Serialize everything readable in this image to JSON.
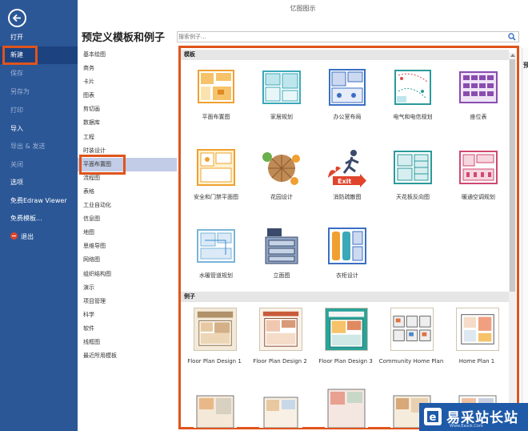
{
  "app": {
    "title": "亿图图示"
  },
  "sidebar": {
    "items": [
      {
        "label": "打开"
      },
      {
        "label": "新建"
      },
      {
        "label": "保存"
      },
      {
        "label": "另存为"
      },
      {
        "label": "打印"
      },
      {
        "label": "导入"
      },
      {
        "label": "导出 & 发送"
      },
      {
        "label": "关闭"
      },
      {
        "label": "选项"
      },
      {
        "label": "免费Edraw Viewer"
      },
      {
        "label": "免费模板..."
      },
      {
        "label": "退出"
      }
    ]
  },
  "header": {
    "title": "预定义模板和例子",
    "search_placeholder": "搜索例子..."
  },
  "categories": [
    "基本绘图",
    "商务",
    "卡片",
    "图表",
    "剪切画",
    "数据库",
    "工程",
    "时装设计",
    "平面布置图",
    "流程图",
    "表格",
    "工业自动化",
    "信息图",
    "地图",
    "思维导图",
    "网络图",
    "组织结构图",
    "演示",
    "项目管理",
    "科学",
    "软件",
    "线框图",
    "最近所用模板"
  ],
  "selected_category": "平面布置图",
  "templates": {
    "section_label": "模板",
    "items": [
      {
        "label": "平面布置图",
        "icon": "floor-plan-icon"
      },
      {
        "label": "家居规划",
        "icon": "home-plan-icon"
      },
      {
        "label": "办公室布局",
        "icon": "office-layout-icon"
      },
      {
        "label": "电气和电信规划",
        "icon": "electrical-plan-icon"
      },
      {
        "label": "座位表",
        "icon": "seating-chart-icon"
      },
      {
        "label": "安全和门禁平面图",
        "icon": "security-plan-icon"
      },
      {
        "label": "花园设计",
        "icon": "garden-design-icon"
      },
      {
        "label": "消防疏散图",
        "icon": "fire-escape-icon"
      },
      {
        "label": "天花板反向图",
        "icon": "ceiling-plan-icon"
      },
      {
        "label": "暖通空调规划",
        "icon": "hvac-plan-icon"
      },
      {
        "label": "水暖管道规划",
        "icon": "plumbing-plan-icon"
      },
      {
        "label": "立面图",
        "icon": "elevation-icon"
      },
      {
        "label": "衣柜设计",
        "icon": "wardrobe-design-icon"
      }
    ]
  },
  "examples": {
    "section_label": "例子",
    "items": [
      {
        "label": "Floor Plan Design 1"
      },
      {
        "label": "Floor Plan Design 2"
      },
      {
        "label": "Floor Plan Design 3"
      },
      {
        "label": "Community Home Plan"
      },
      {
        "label": "Home Plan 1"
      }
    ]
  },
  "right_panel": {
    "label": "预"
  },
  "watermark": {
    "text": "易采站长站",
    "url": "Www.Easck.Com"
  },
  "colors": {
    "sidebar_bg": "#2b5797",
    "highlight": "#e0541c",
    "selected_category": "#c2cce6",
    "icon_teal": "#3aa8b8",
    "icon_orange": "#f0a030"
  }
}
